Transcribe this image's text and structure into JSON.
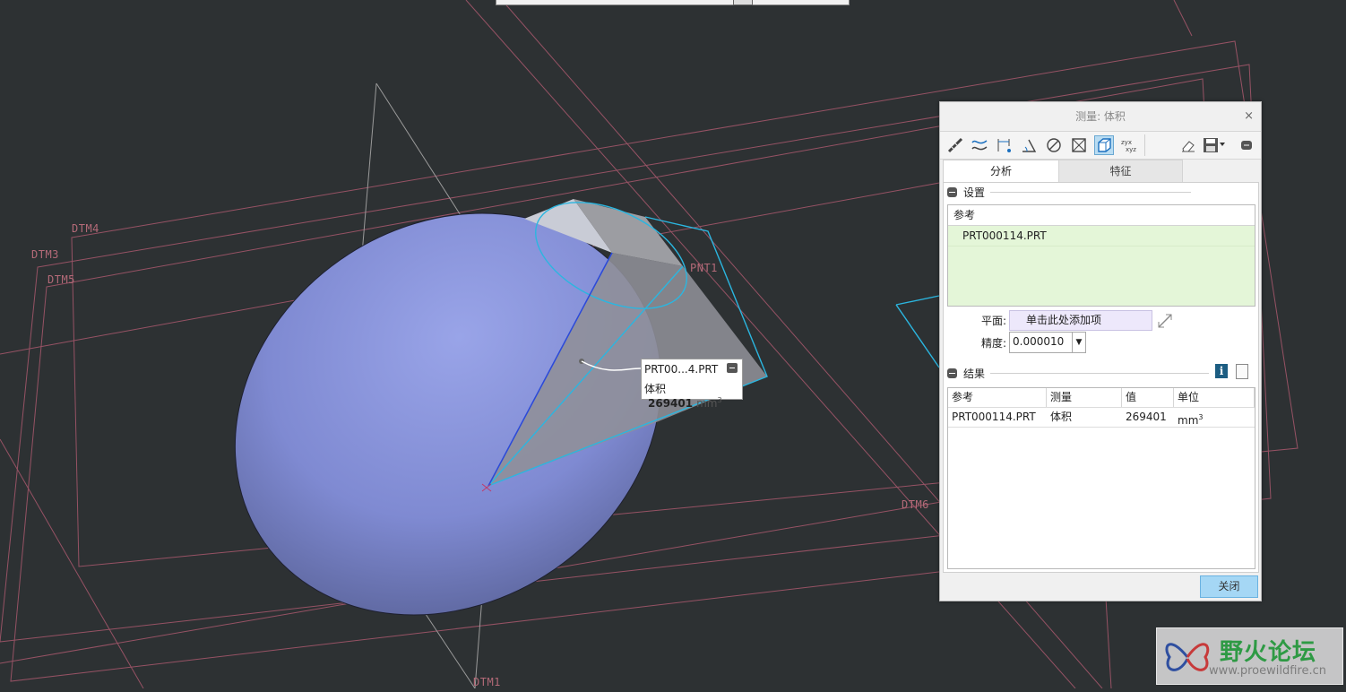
{
  "viewport": {
    "datums": [
      "DTM4",
      "DTM3",
      "DTM5",
      "DTM6",
      "DTM1"
    ],
    "point_label": "PNT1",
    "callout": {
      "name": "PRT00...4.PRT",
      "quantity": "体积",
      "value": "269401",
      "unit": "mm",
      "unit_exp": "3"
    }
  },
  "dialog": {
    "title": "测量: 体积",
    "close_glyph": "×",
    "tabs": [
      "分析",
      "特征"
    ],
    "setup": {
      "header": "设置",
      "ref_header": "参考",
      "ref_item": "PRT000114.PRT",
      "plane_label": "平面:",
      "plane_placeholder": "单击此处添加项",
      "precision_label": "精度:",
      "precision_value": "0.000010"
    },
    "results": {
      "header": "结果",
      "columns": [
        "参考",
        "测量",
        "值",
        "单位"
      ],
      "rows": [
        {
          "ref": "PRT000114.PRT",
          "measure": "体积",
          "value": "269401",
          "unit": "mm",
          "unit_exp": "3"
        }
      ]
    },
    "close_button": "关闭"
  },
  "watermark": {
    "title": "野火论坛",
    "url": "www.proewildfire.cn"
  },
  "colors": {
    "model": "#8391d8",
    "datum": "#b46a78",
    "highlight": "#2bb6e0",
    "dialog_bg": "#f0f0f0",
    "ref_bg": "#e4f6d8"
  }
}
